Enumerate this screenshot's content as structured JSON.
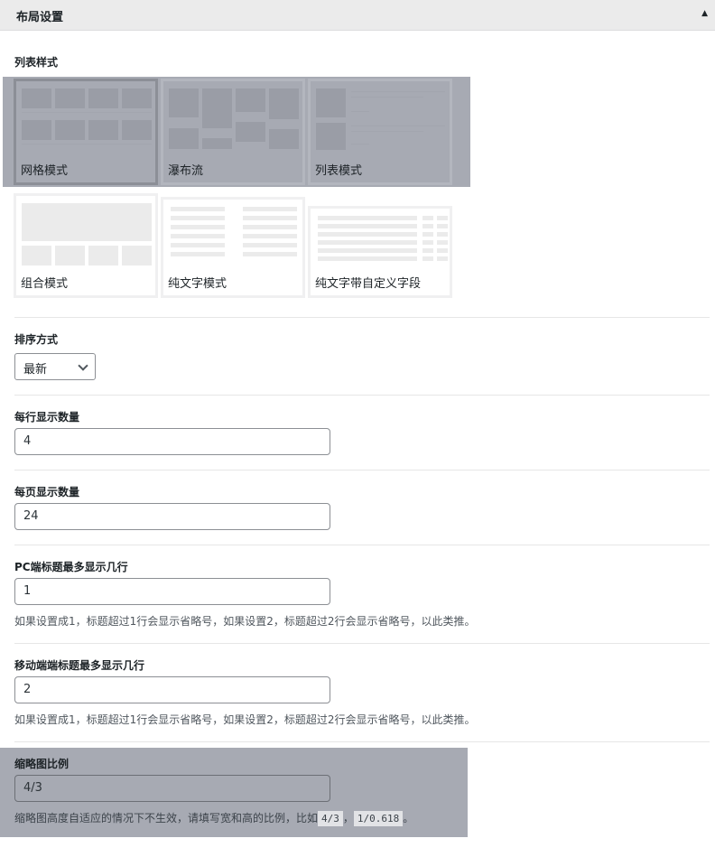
{
  "panel": {
    "title": "布局设置",
    "toggle_icon": "▲"
  },
  "list_style": {
    "label": "列表样式",
    "options": [
      {
        "label": "网格模式"
      },
      {
        "label": "瀑布流"
      },
      {
        "label": "列表模式"
      },
      {
        "label": "组合模式"
      },
      {
        "label": "纯文字模式"
      },
      {
        "label": "纯文字带自定义字段"
      }
    ]
  },
  "sort": {
    "label": "排序方式",
    "value": "最新"
  },
  "per_row": {
    "label": "每行显示数量",
    "value": "4"
  },
  "per_page": {
    "label": "每页显示数量",
    "value": "24"
  },
  "pc_title_lines": {
    "label": "PC端标题最多显示几行",
    "value": "1",
    "desc": "如果设置成1，标题超过1行会显示省略号，如果设置2，标题超过2行会显示省略号，以此类推。"
  },
  "mobile_title_lines": {
    "label": "移动端端标题最多显示几行",
    "value": "2",
    "desc": "如果设置成1，标题超过1行会显示省略号，如果设置2，标题超过2行会显示省略号，以此类推。"
  },
  "thumb_ratio": {
    "label": "缩略图比例",
    "value": "4/3",
    "desc_before": "缩略图高度自适应的情况下不生效，请填写宽和高的比例，比如",
    "example1": "4/3",
    "sep": "，",
    "example2": "1/0.618",
    "desc_after": "。"
  }
}
